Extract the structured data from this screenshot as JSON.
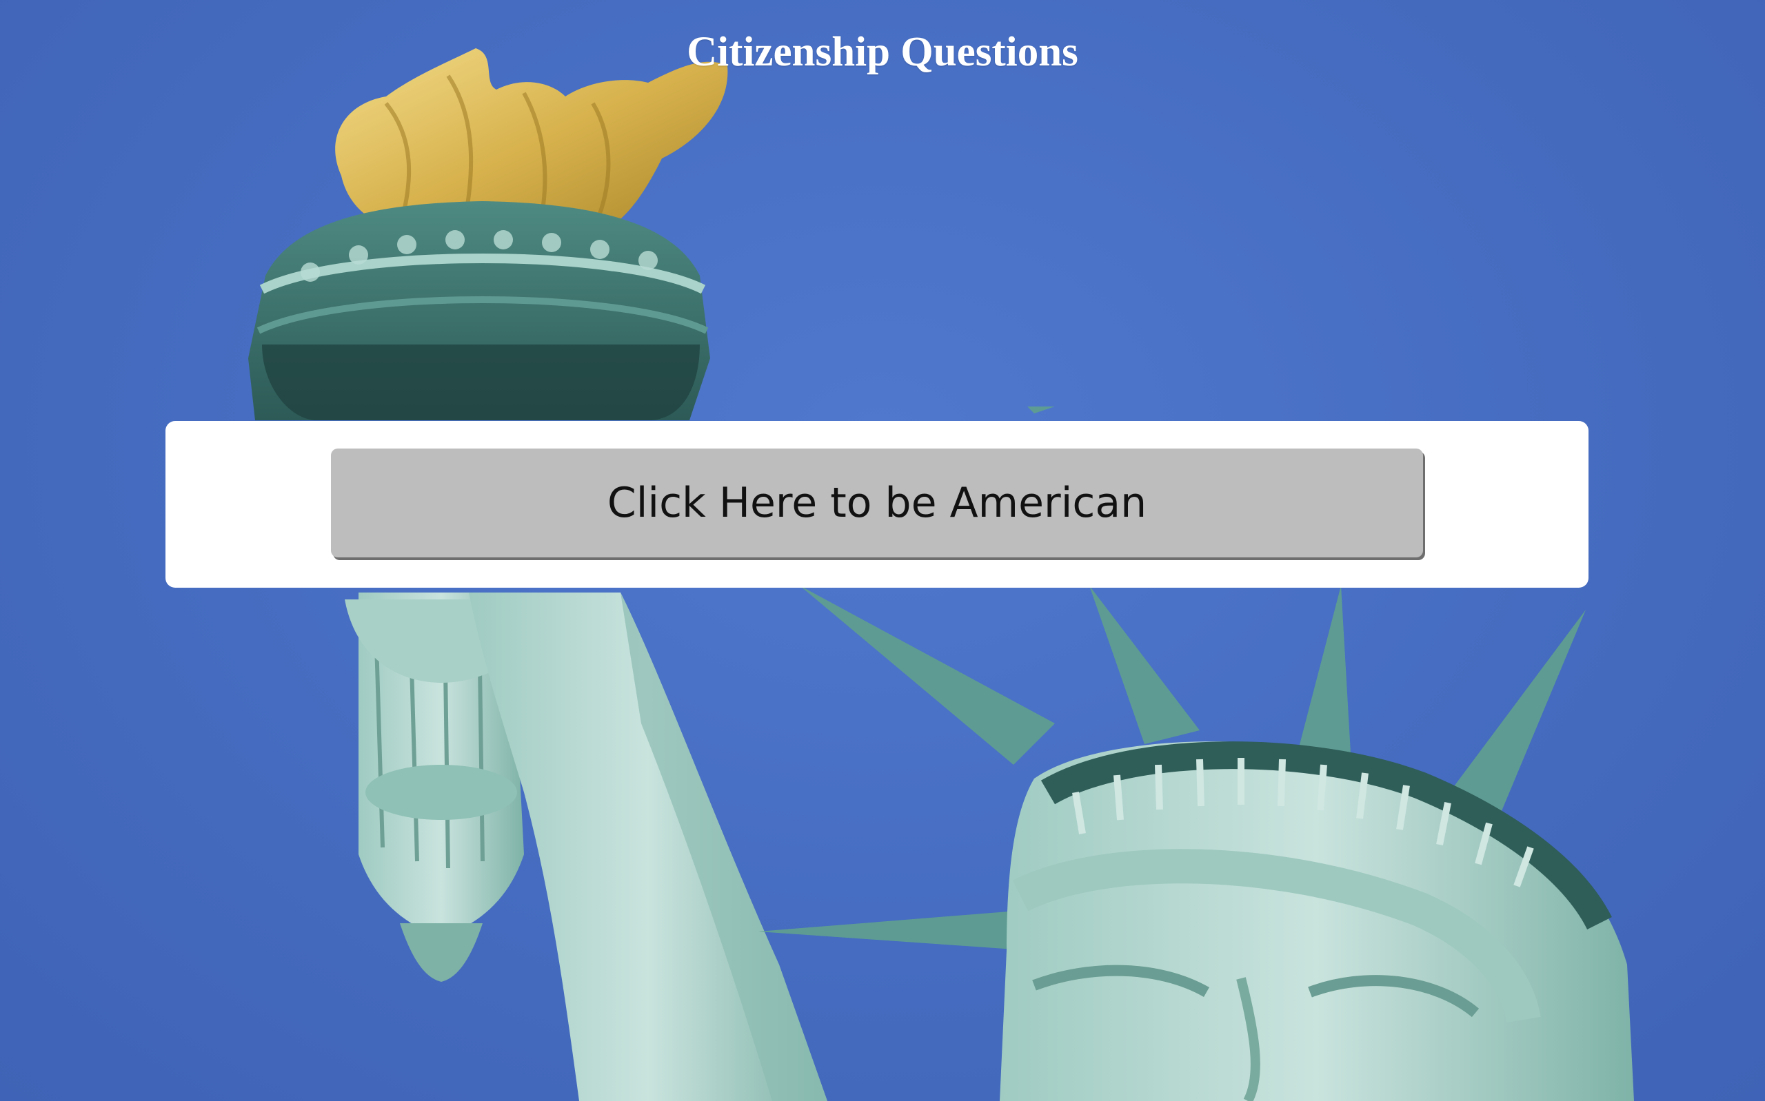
{
  "page": {
    "title": "Citizenship Questions",
    "background_image": "statue-of-liberty-photo"
  },
  "cta": {
    "label": "Click Here to be American"
  },
  "colors": {
    "sky": "#4a6fc4",
    "title_text": "#ffffff",
    "card_background": "#ffffff",
    "button_background": "#bdbdbd",
    "button_text": "#111111"
  }
}
